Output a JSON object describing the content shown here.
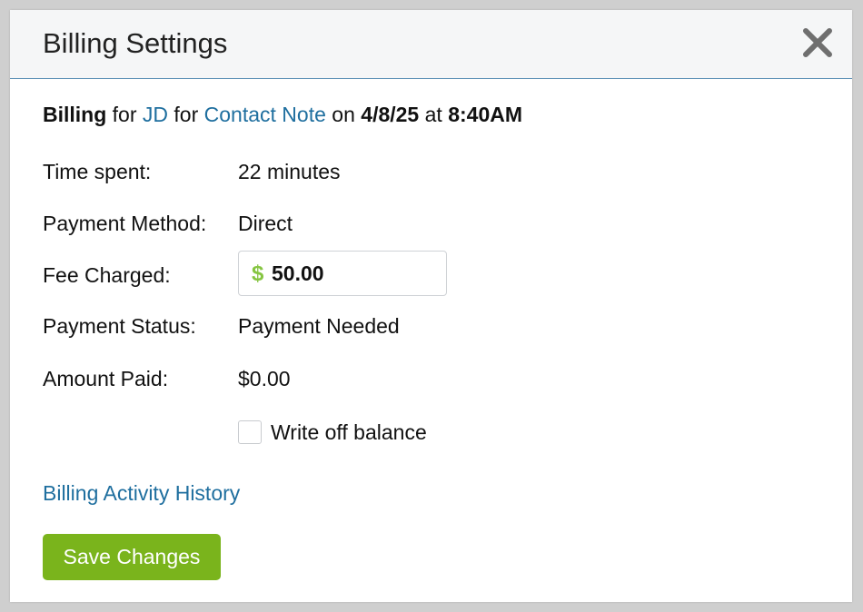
{
  "dialog": {
    "title": "Billing Settings",
    "close_icon": "close-x-icon"
  },
  "summary": {
    "billing": "Billing",
    "for1": "for",
    "client": "JD",
    "for2": "for",
    "note_type": "Contact Note",
    "on": "on",
    "date": "4/8/25",
    "at": "at",
    "time": "8:40AM"
  },
  "fields": {
    "time_spent": {
      "label": "Time spent:",
      "value": "22 minutes"
    },
    "payment_method": {
      "label": "Payment Method:",
      "value": "Direct"
    },
    "fee_charged": {
      "label": "Fee Charged:",
      "currency": "$",
      "value": "50.00"
    },
    "payment_status": {
      "label": "Payment Status:",
      "value": "Payment Needed"
    },
    "amount_paid": {
      "label": "Amount Paid:",
      "value": "$0.00"
    }
  },
  "write_off": {
    "label": "Write off balance",
    "checked": false
  },
  "history_link": "Billing Activity History",
  "save_button": "Save Changes",
  "colors": {
    "accent_green": "#7ab41c",
    "currency_green": "#86c542",
    "link_blue": "#1f6f9f",
    "header_border": "#5b8fb5"
  }
}
